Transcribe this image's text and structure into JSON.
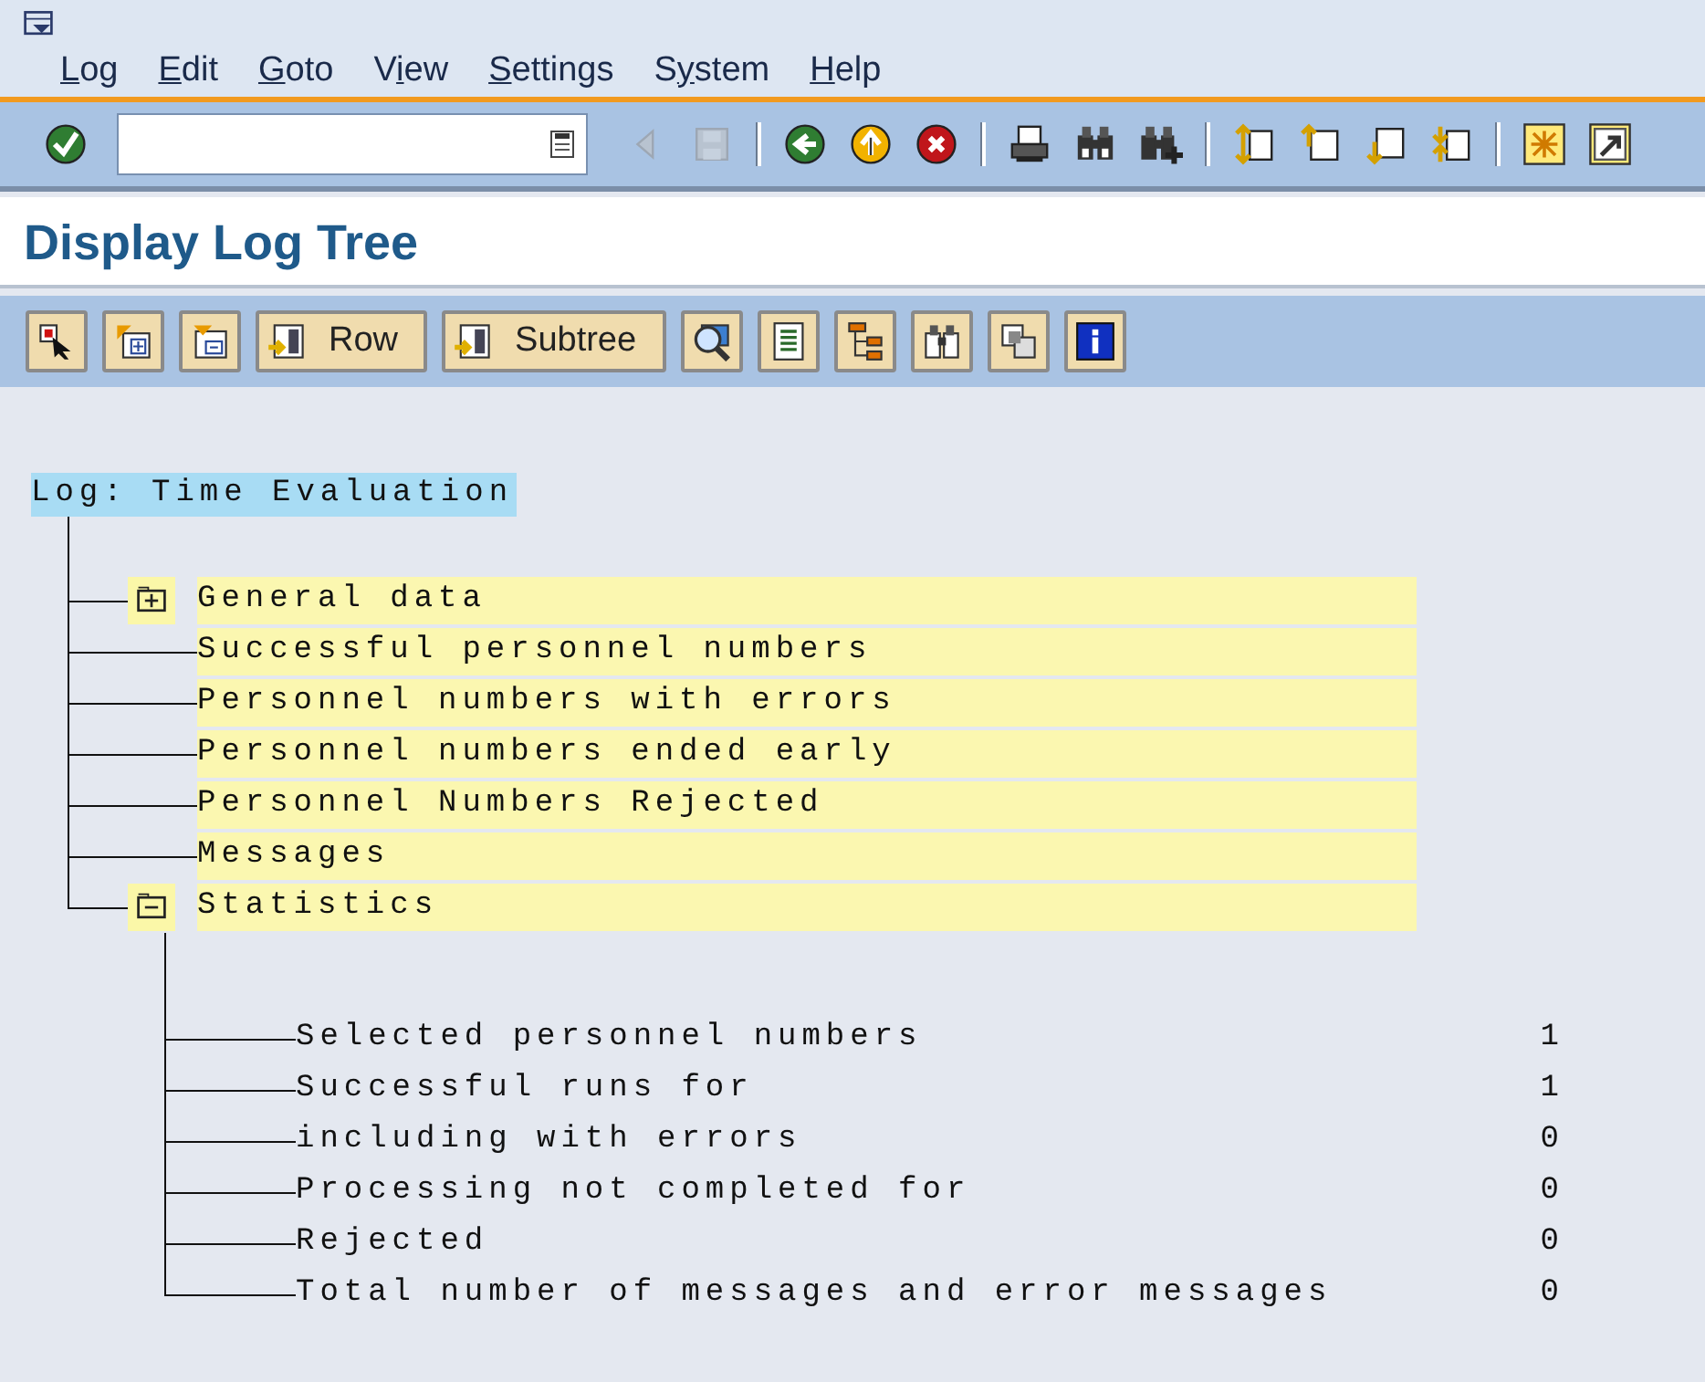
{
  "menu": [
    {
      "key": "L",
      "after": "og"
    },
    {
      "key": "E",
      "after": "dit"
    },
    {
      "key": "G",
      "after": "oto"
    },
    {
      "before": "V",
      "key": "i",
      "after": "ew"
    },
    {
      "key": "S",
      "after": "ettings"
    },
    {
      "before": "S",
      "key": "y",
      "after": "stem"
    },
    {
      "key": "H",
      "after": "elp"
    }
  ],
  "toolbar": {
    "buttons": [
      {
        "kind": "enter",
        "disabled": false
      },
      {
        "kind": "command_field"
      },
      {
        "kind": "back_small",
        "disabled": true
      },
      {
        "kind": "save",
        "disabled": true
      },
      {
        "kind": "separator"
      },
      {
        "kind": "back",
        "disabled": false
      },
      {
        "kind": "exit",
        "disabled": false
      },
      {
        "kind": "cancel",
        "disabled": false
      },
      {
        "kind": "separator"
      },
      {
        "kind": "print",
        "disabled": false
      },
      {
        "kind": "find",
        "disabled": false
      },
      {
        "kind": "find_next",
        "disabled": false
      },
      {
        "kind": "separator"
      },
      {
        "kind": "first_page",
        "disabled": false
      },
      {
        "kind": "previous_page",
        "disabled": false
      },
      {
        "kind": "next_page",
        "disabled": false
      },
      {
        "kind": "last_page",
        "disabled": false
      },
      {
        "kind": "separator"
      },
      {
        "kind": "new_session",
        "disabled": false
      },
      {
        "kind": "shortcut",
        "disabled": false
      }
    ]
  },
  "title": "Display Log Tree",
  "app_toolbar": [
    {
      "kind": "select"
    },
    {
      "kind": "expand"
    },
    {
      "kind": "collapse"
    },
    {
      "kind": "row",
      "label": "Row"
    },
    {
      "kind": "subtree",
      "label": "Subtree"
    },
    {
      "kind": "detail"
    },
    {
      "kind": "list"
    },
    {
      "kind": "hierarchy"
    },
    {
      "kind": "find"
    },
    {
      "kind": "copy"
    },
    {
      "kind": "info"
    }
  ],
  "tree": {
    "root": {
      "label": "Log: Time Evaluation",
      "selected": true
    },
    "children": [
      {
        "kind": "folder",
        "label": "General data",
        "expanded": false
      },
      {
        "kind": "leaf",
        "label": "Successful personnel numbers"
      },
      {
        "kind": "leaf",
        "label": "Personnel numbers with errors"
      },
      {
        "kind": "leaf",
        "label": "Personnel numbers ended early"
      },
      {
        "kind": "leaf",
        "label": "Personnel Numbers Rejected"
      },
      {
        "kind": "leaf",
        "label": "Messages"
      },
      {
        "kind": "folder",
        "label": "Statistics",
        "expanded": true,
        "children": [
          {
            "label": "Selected personnel numbers",
            "value": "1"
          },
          {
            "label": "Successful runs for",
            "value": "1"
          },
          {
            "label": "including with errors",
            "value": "0"
          },
          {
            "label": "Processing not completed for",
            "value": "0"
          },
          {
            "label": "Rejected",
            "value": "0"
          },
          {
            "label": "Total number of messages and error messages",
            "value": "0"
          }
        ]
      }
    ]
  }
}
